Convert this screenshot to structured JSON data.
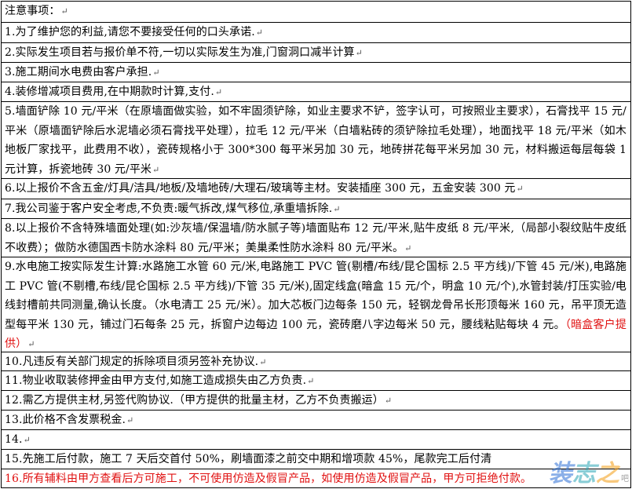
{
  "title": "注意事项：",
  "para_mark": "↵",
  "items": {
    "i1": "1.为了维护您的利益,请您不要接受任何的口头承诺.",
    "i2": "2.实际发生项目若与报价单不符,一切以实际发生为准,门窗洞口减半计算",
    "i3": "3.施工期间水电费由客户承担.",
    "i4": "4.装修增减项目费用,在中期款时计算,支付.",
    "i5": "5.墙面铲除 10 元/平米（在原墙面做实验，如不牢固须铲除，如业主要求不铲，签字认可，可按照业主要求），石膏找平 15 元/平米（原墙面铲除后水泥墙必须石膏找平处理），拉毛 12 元/平米（白墙粘砖的须铲除拉毛处理），地面找平 18 元/平米（如木地板厂家找平，此费用不收），瓷砖规格小于 300*300 每平米另加 30 元，地砖拼花每平米另加 30 元，材料搬运每层每袋 1 元计算，拆瓷地砖 30 元/平米",
    "i6": "6.以上报价不含五金/灯具/洁具/地板/及墙地砖/大理石/玻璃等主材。安装插座 300 元，五金安装 300 元",
    "i7": "7.我公司鉴于客户安全考虑,不负责:暖气拆改,煤气移位,承重墙拆除.",
    "i8": "8.以上报价不含特殊墙面处理(如:沙灰墙/保温墙/防水腻子等)墙面贴布 12 元/平米,贴牛皮纸 8 元/平米,（局部小裂纹贴牛皮纸不收费）；做防水德国西卡防水涂料 80 元/平米；美巢柔性防水涂料 80 元/平米。",
    "i9": "9.水电施工按实际发生计算:水路施工水管 60 元/米,电路施工 PVC 管(剔槽/布线/昆仑国标 2.5 平方线)/下管 45 元/米),电路施工 PVC 管(不剔槽,布线/昆仑国标 2.5 平方线)/下管 35 元/米),固定线盒(暗盒 15 元/个，明盒 10 元/个),水管封装/打压实验/电线封槽前共同测量,确认长度。（水电清工 25 元/米）。加大芯板门边每条 150 元，轻钢龙骨吊长形顶每米 160 元，吊平顶无造型每平米 130 元，铺过门石每条 25 元，拆窗户边每边 100 元，瓷砖磨八字边每米 50 元，腰线粘贴每块 4 元。",
    "i9_red": "（暗盒客户提供）",
    "i10": "10.凡违反有关部门规定的拆除项目须另签补充协议.",
    "i11": "11.物业收取装修押金由甲方支付,如施工造成损失由乙方负责.",
    "i12": "12.需乙方提供主材,另签代购协议.（甲方提供的批量主材，乙方不负责搬运）",
    "i13": "13.此价格不含发票税金.",
    "i14": "14.",
    "i15": "15.先施工后付款，施工 7 天后交首付 50%，刷墙面漆之前交中期和增项款 45%，尾款完工后付清",
    "i16": "16.所有辅料由甲方查看后方可施工，不可使用仿造及假冒产品，如使用仿造及假冒产品，甲方可拒绝付款。"
  },
  "watermark": {
    "c1": "装",
    "c2": "志",
    "c3": "之",
    "small": "吧"
  },
  "colors": {
    "text": "#000000",
    "red": "#e01010",
    "border": "#000000"
  }
}
